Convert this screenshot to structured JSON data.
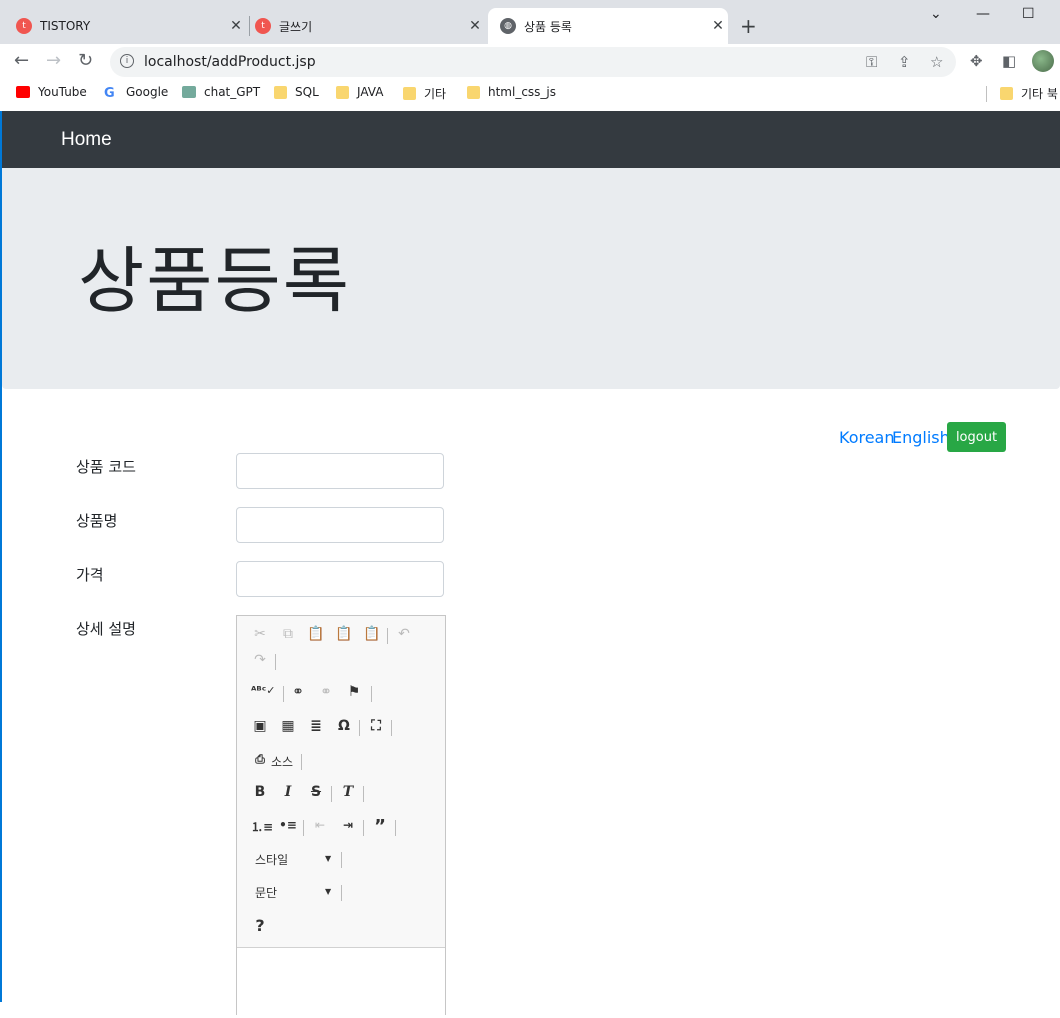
{
  "browser": {
    "tabs": [
      {
        "title": "TISTORY"
      },
      {
        "title": "글쓰기"
      },
      {
        "title": "상품 등록"
      }
    ],
    "url": "localhost/addProduct.jsp",
    "bookmarks": [
      "YouTube",
      "Google",
      "chat_GPT",
      "SQL",
      "JAVA",
      "기타",
      "html_css_js"
    ],
    "other_bookmarks": "기타 북"
  },
  "navbar": {
    "brand": "Home"
  },
  "jumbotron": {
    "title": "상품등록"
  },
  "lang": {
    "korean": "Korean",
    "english": "English"
  },
  "logout_label": "logout",
  "form": {
    "code_label": "상품 코드",
    "name_label": "상품명",
    "price_label": "가격",
    "desc_label": "상세 설명"
  },
  "editor": {
    "source_label": "소스",
    "style_combo": "스타일",
    "format_combo": "문단",
    "help": "?"
  }
}
